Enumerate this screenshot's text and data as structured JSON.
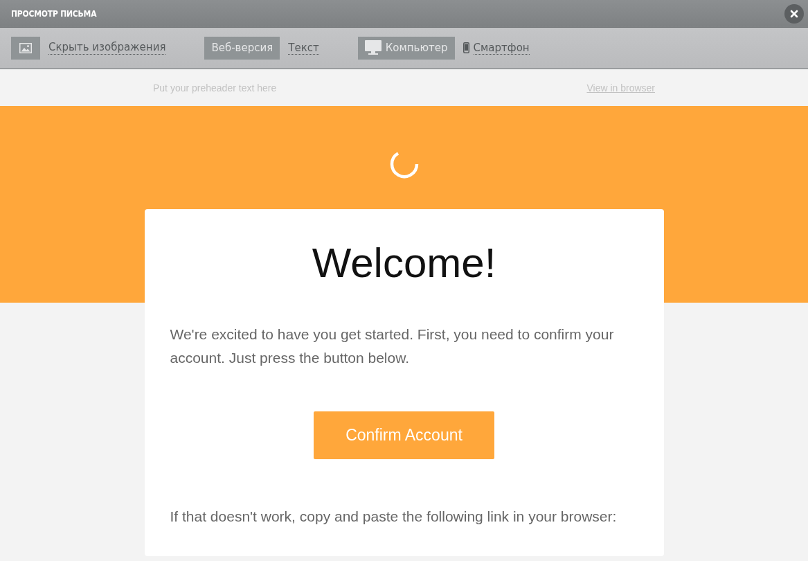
{
  "window": {
    "title": "ПРОСМОТР ПИСЬМА"
  },
  "toolbar": {
    "images_link": "Скрыть изображения",
    "format_tabs": [
      {
        "label": "Веб-версия",
        "selected": true
      },
      {
        "label": "Текст",
        "selected": false
      }
    ],
    "device_tabs": [
      {
        "label": "Компьютер",
        "selected": true,
        "kind": "desktop"
      },
      {
        "label": "Смартфон",
        "selected": false,
        "kind": "phone"
      }
    ]
  },
  "preheader": {
    "text": "Put your preheader text here",
    "link": "View in browser"
  },
  "email": {
    "heading": "Welcome!",
    "intro": "We're excited to have you get started. First, you need to confirm your account. Just press the button below.",
    "button": "Confirm Account",
    "fallback": "If that doesn't work, copy and paste the following link in your browser:"
  }
}
